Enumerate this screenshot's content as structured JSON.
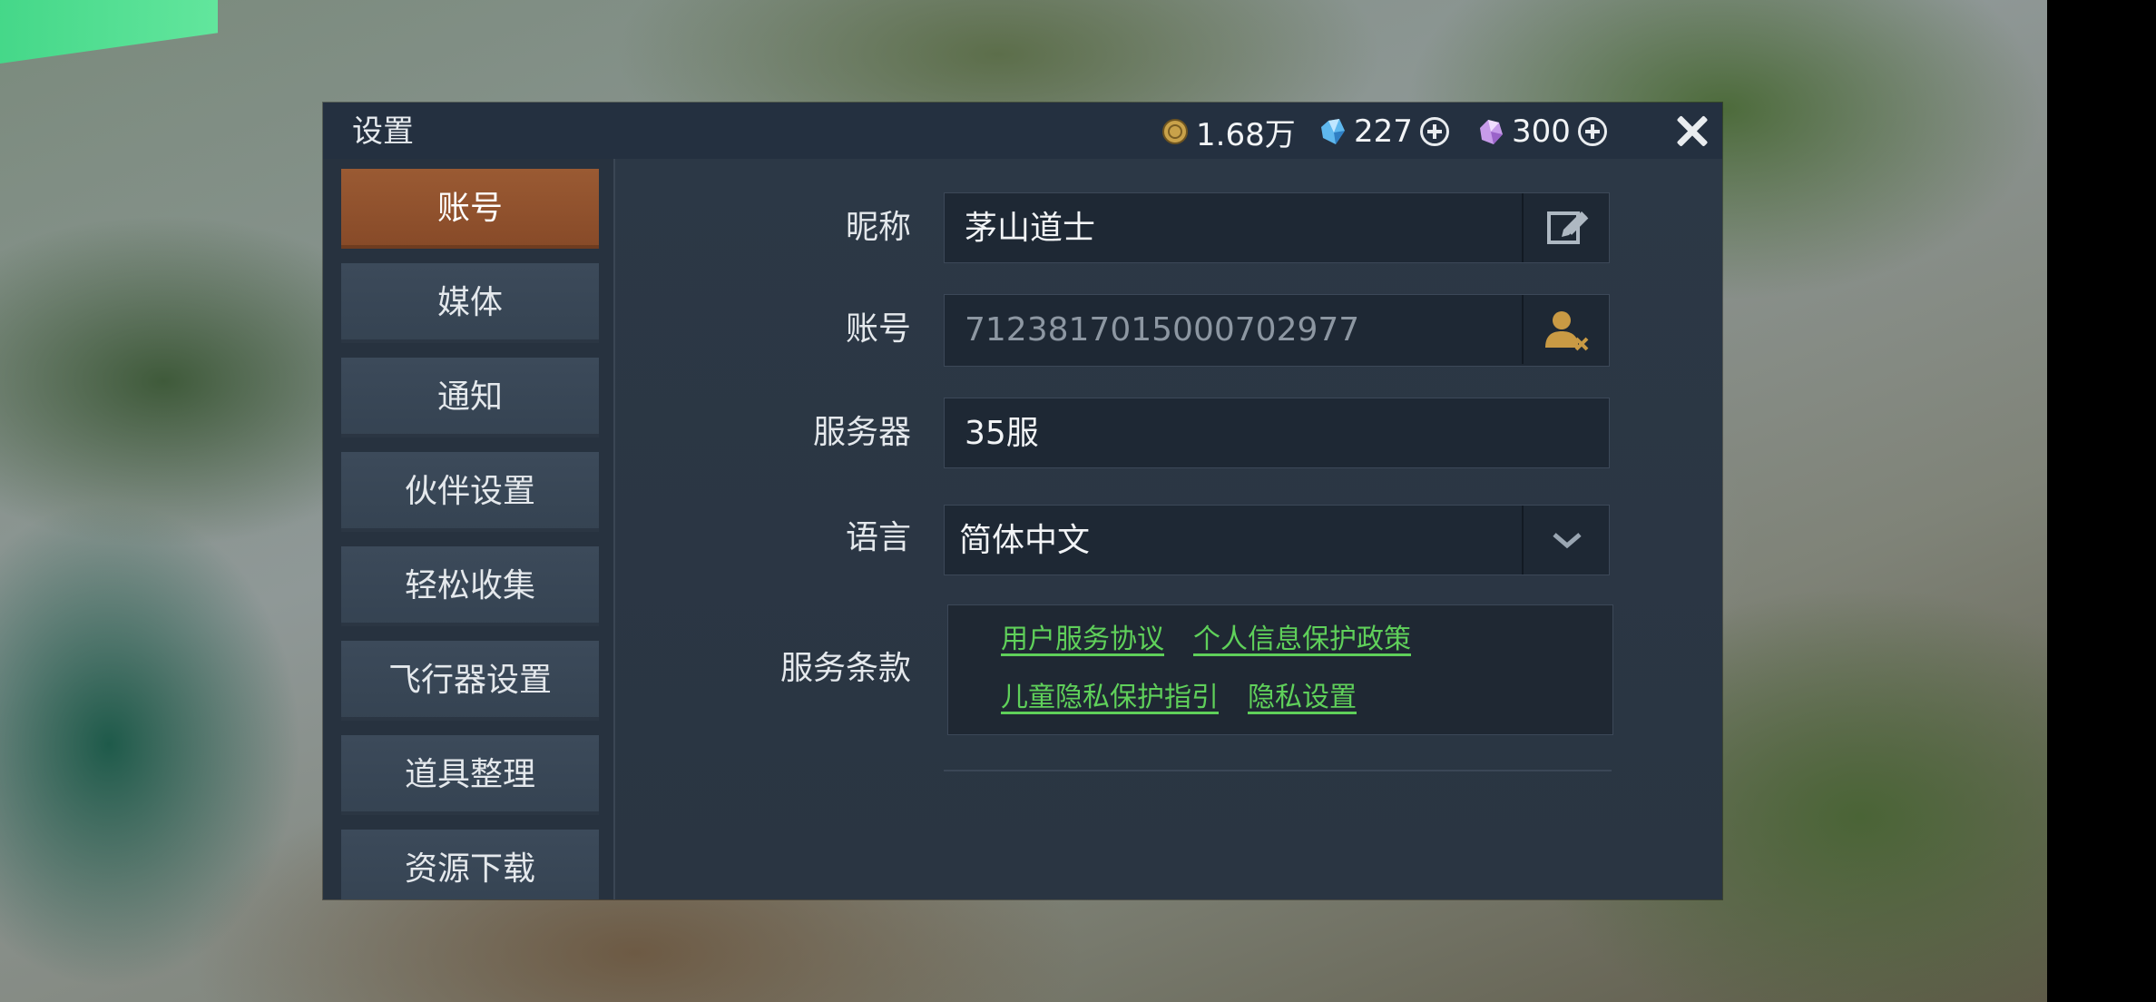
{
  "header": {
    "title": "设置",
    "currencies": [
      {
        "icon": "gold-coin-icon",
        "value": "1.68万"
      },
      {
        "icon": "blue-crystal-icon",
        "value": "227"
      },
      {
        "icon": "purple-crystal-icon",
        "value": "300"
      }
    ]
  },
  "sidebar": {
    "items": [
      {
        "label": "账号",
        "active": true
      },
      {
        "label": "媒体"
      },
      {
        "label": "通知"
      },
      {
        "label": "伙伴设置"
      },
      {
        "label": "轻松收集"
      },
      {
        "label": "飞行器设置"
      },
      {
        "label": "道具整理"
      },
      {
        "label": "资源下载"
      }
    ]
  },
  "form": {
    "nickname": {
      "label": "昵称",
      "value": "茅山道士",
      "action_icon": "edit-icon"
    },
    "account": {
      "label": "账号",
      "value": "7123817015000702977",
      "action_icon": "unbind-user-icon"
    },
    "server": {
      "label": "服务器",
      "value": "35服"
    },
    "language": {
      "label": "语言",
      "value": "简体中文",
      "action_icon": "chevron-down-icon"
    },
    "terms": {
      "label": "服务条款",
      "links": [
        "用户服务协议",
        "个人信息保护政策",
        "儿童隐私保护指引",
        "隐私设置"
      ]
    }
  },
  "colors": {
    "accent": "#8e4f2b",
    "link": "#5fd05a",
    "panel": "#2c3846"
  }
}
